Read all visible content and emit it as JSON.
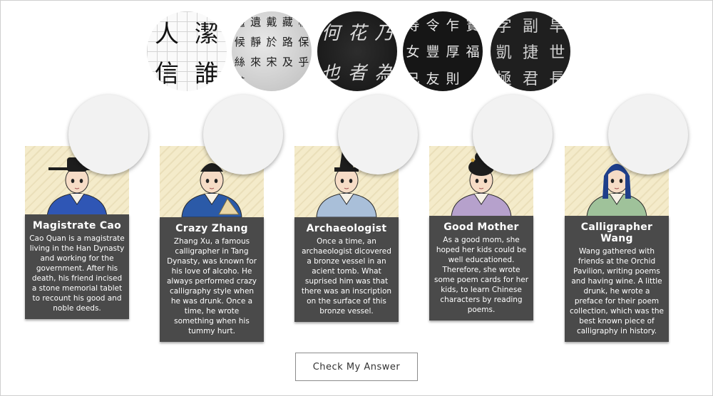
{
  "samples": [
    {
      "style": "regular",
      "text": "人潔信誰"
    },
    {
      "style": "running",
      "text": "遙遺戴藏帆候靜於路保絲來宋及乎其"
    },
    {
      "style": "cursive",
      "text": "何花乃也者為"
    },
    {
      "style": "bronze",
      "text": "寿令乍寶女豐厚福己友則"
    },
    {
      "style": "clerical",
      "text": "字副旱凱捷世極君長"
    }
  ],
  "characters": [
    {
      "name": "Magistrate Cao",
      "bio": "Cao Quan is a magistrate living in the Han Dynasty and working for the government.  After his death, his friend incised a stone memorial tablet to recount his good and noble deeds.",
      "robe_color": "#2f56b5",
      "hat": "official"
    },
    {
      "name": "Crazy Zhang",
      "bio": "Zhang Xu, a famous calligrapher in Tang Dynasty, was known for his love of alcoho. He always performed crazy calligraphy style when he was drunk. Once a time, he wrote something when his tummy hurt.",
      "robe_color": "#2b5aa8",
      "hat": "scholar"
    },
    {
      "name": "Archaeologist",
      "bio": "Once a time, an archaeologist dicovered a bronze vessel in an acient tomb. What suprised him was that there was an inscription on the surface of this bronze vessel.",
      "robe_color": "#a9bfd9",
      "hat": "tall"
    },
    {
      "name": "Good Mother",
      "bio": "As a good mom, she hoped her kids could be well educationed. Therefore, she wrote some poem cards for her kids, to learn Chinese characters by reading poems.",
      "robe_color": "#b6a1cc",
      "hat": "bun"
    },
    {
      "name": "Calligrapher Wang",
      "bio": "Wang gathered with friends at the Orchid Pavilion, writing poems and having wine. A little drunk, he wrote a preface for their poem collection, which was the best known piece of calligraphy in history.",
      "robe_color": "#9fc29a",
      "hat": "scarf"
    }
  ],
  "check_button": {
    "label": "Check My Answer"
  }
}
